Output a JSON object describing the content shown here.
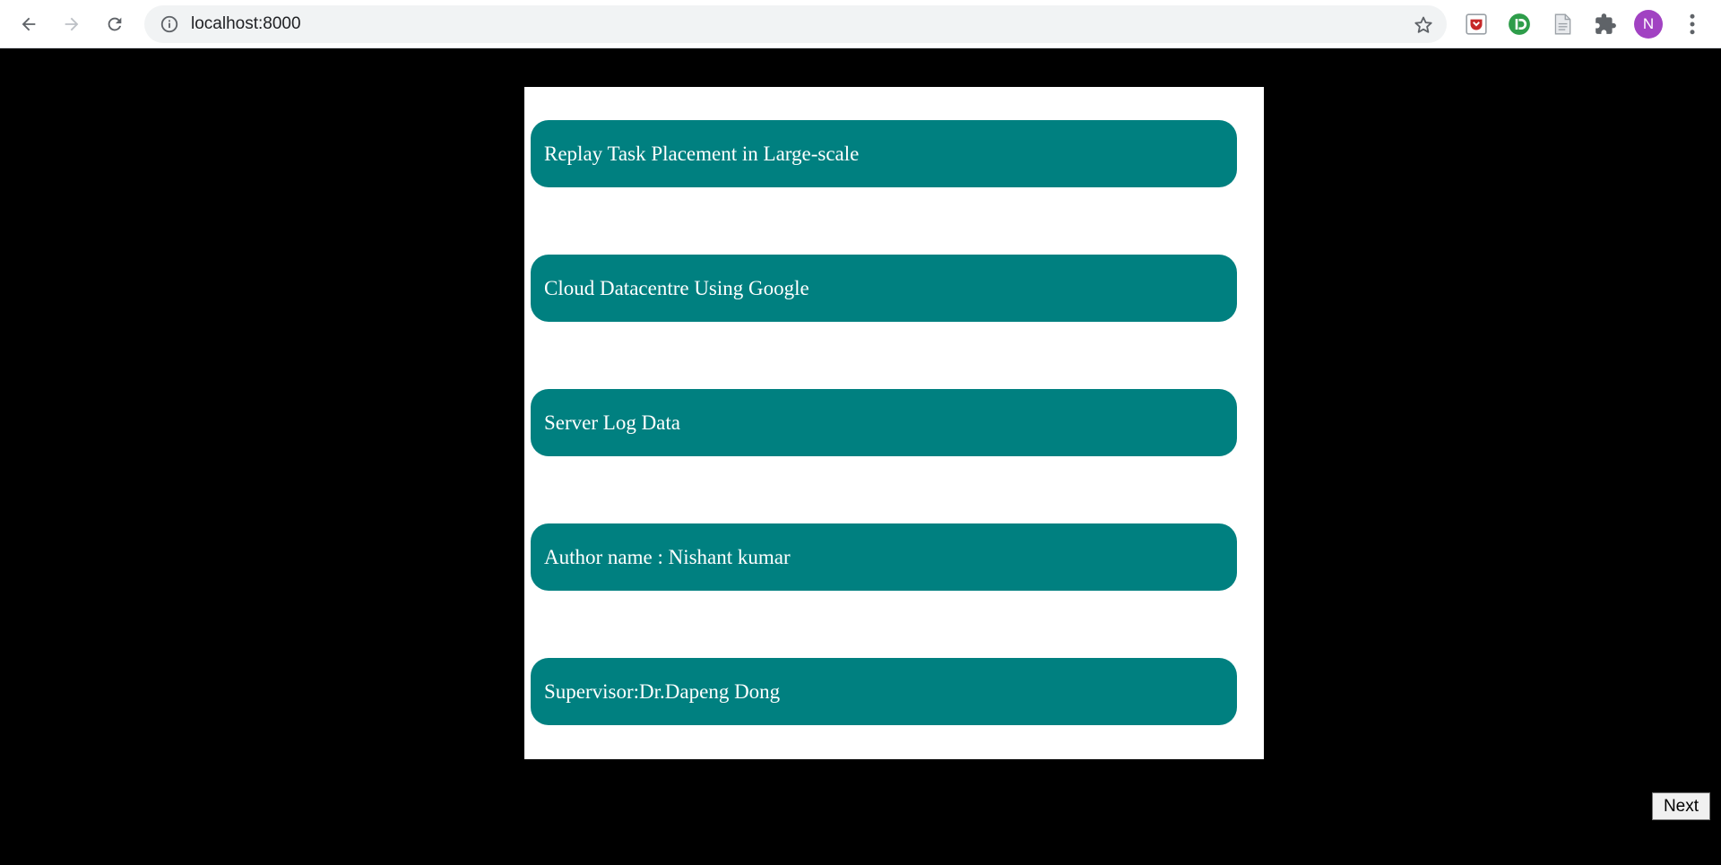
{
  "browser": {
    "url": "localhost:8000",
    "profile_initial": "N",
    "icons": [
      "back-arrow-icon",
      "forward-arrow-icon",
      "reload-icon",
      "info-icon",
      "star-icon",
      "pocket-extension-icon",
      "green-extension-icon",
      "document-extension-icon",
      "puzzle-extensions-icon",
      "more-vert-icon"
    ]
  },
  "cards": [
    {
      "text": "Replay Task Placement in Large-scale"
    },
    {
      "text": "Cloud Datacentre Using Google"
    },
    {
      "text": "Server Log Data"
    },
    {
      "text": "Author name : Nishant kumar"
    },
    {
      "text": "Supervisor:Dr.Dapeng Dong"
    }
  ],
  "next_label": "Next",
  "colors": {
    "background": "#000000",
    "panel": "#ffffff",
    "card": "#008080",
    "card_text": "#ffffff"
  }
}
